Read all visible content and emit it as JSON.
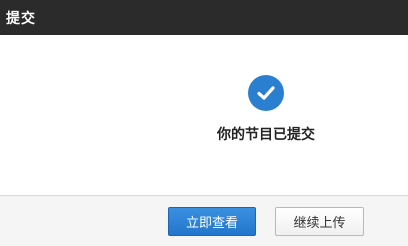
{
  "dialog": {
    "title": "提交",
    "message": "你的节目已提交",
    "status_icon": "check-circle-icon",
    "accent_color": "#2a7fd1"
  },
  "footer": {
    "view_now_label": "立即查看",
    "continue_upload_label": "继续上传"
  }
}
